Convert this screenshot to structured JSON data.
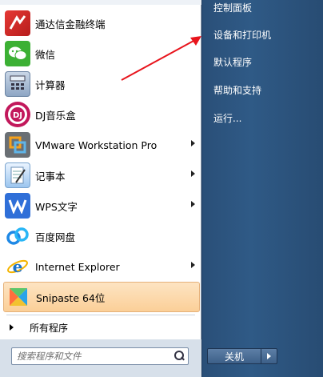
{
  "programs": [
    {
      "label": "通达信金融终端",
      "icon": "tdx-icon",
      "submenu": false
    },
    {
      "label": "微信",
      "icon": "wechat-icon",
      "submenu": false
    },
    {
      "label": "计算器",
      "icon": "calculator-icon",
      "submenu": false
    },
    {
      "label": "DJ音乐盒",
      "icon": "dj-music-icon",
      "submenu": false
    },
    {
      "label": "VMware Workstation Pro",
      "icon": "vmware-icon",
      "submenu": true
    },
    {
      "label": "记事本",
      "icon": "notepad-icon",
      "submenu": true
    },
    {
      "label": "WPS文字",
      "icon": "wps-icon",
      "submenu": true
    },
    {
      "label": "百度网盘",
      "icon": "baidu-netdisk-icon",
      "submenu": false
    },
    {
      "label": "Internet Explorer",
      "icon": "ie-icon",
      "submenu": true
    },
    {
      "label": "Snipaste 64位",
      "icon": "snipaste-icon",
      "submenu": false,
      "highlighted": true
    }
  ],
  "all_programs": "所有程序",
  "search": {
    "placeholder": "搜索程序和文件"
  },
  "right_items": [
    "控制面板",
    "设备和打印机",
    "默认程序",
    "帮助和支持",
    "运行..."
  ],
  "shutdown": {
    "label": "关机"
  },
  "colors": {
    "arrow": "#e8141c",
    "highlight": "#fbcf98",
    "right_pane": "#2f5a86"
  }
}
